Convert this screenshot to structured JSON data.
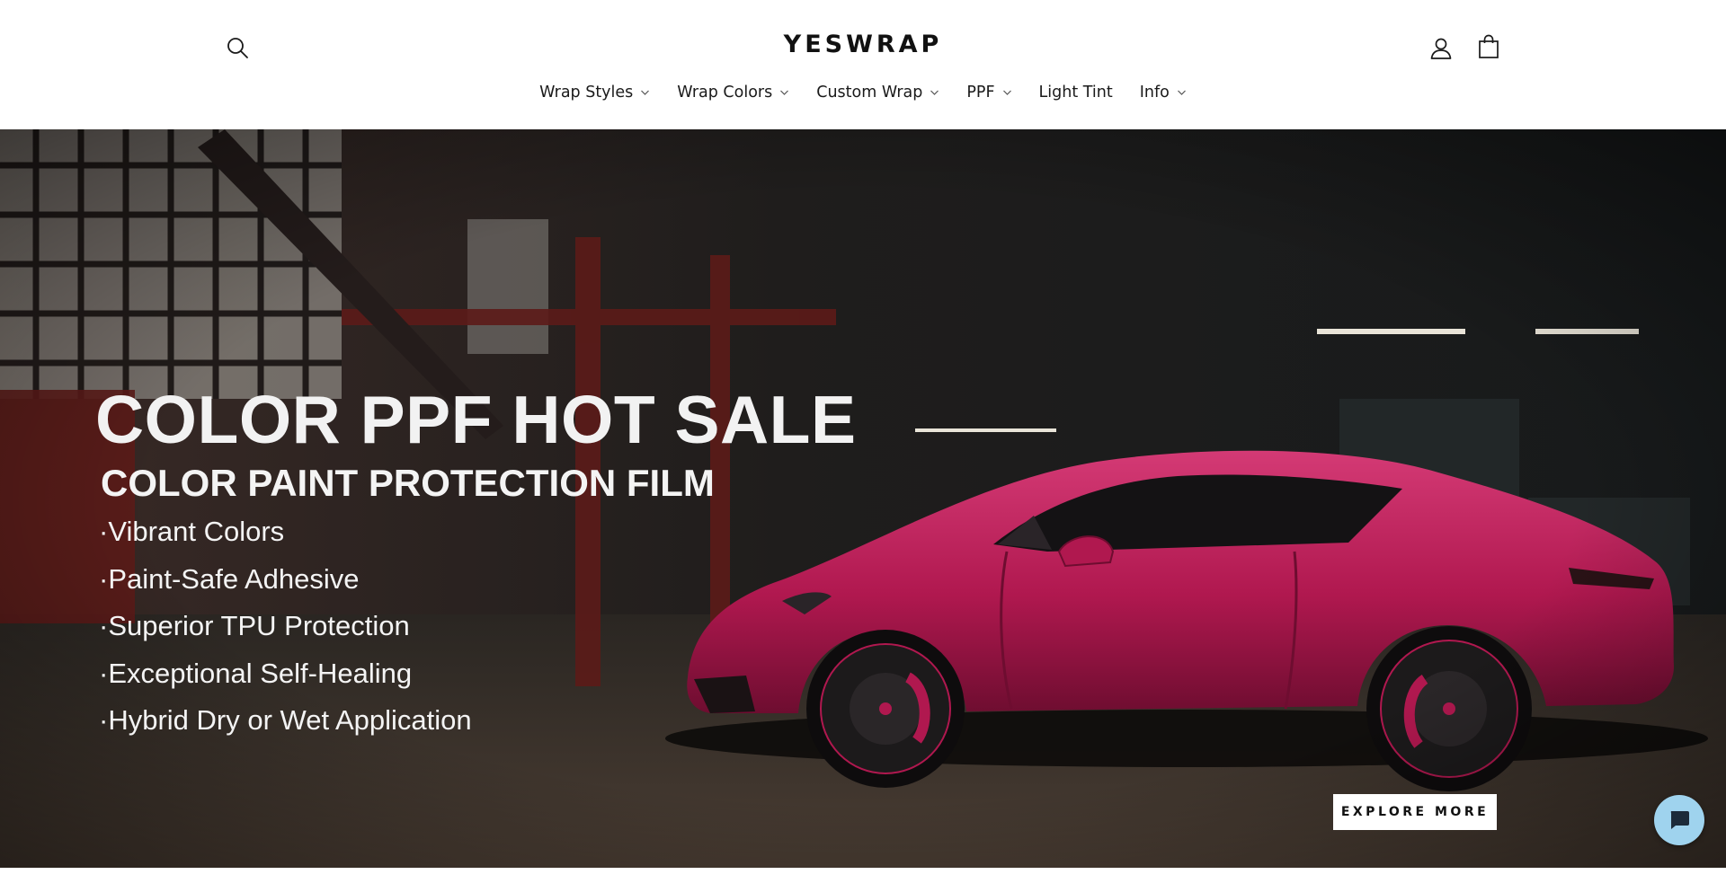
{
  "header": {
    "logo_text": "YESWRAP",
    "search_icon": "search-icon",
    "account_icon": "user-icon",
    "cart_icon": "shopping-bag-icon"
  },
  "nav": {
    "items": [
      {
        "label": "Wrap Styles",
        "has_dropdown": true
      },
      {
        "label": "Wrap Colors",
        "has_dropdown": true
      },
      {
        "label": "Custom Wrap",
        "has_dropdown": true
      },
      {
        "label": "PPF",
        "has_dropdown": true
      },
      {
        "label": "Light Tint",
        "has_dropdown": false
      },
      {
        "label": "Info",
        "has_dropdown": true
      }
    ]
  },
  "hero": {
    "title": "COLOR PPF HOT SALE",
    "subtitle": "COLOR PAINT PROTECTION FILM",
    "features": [
      "·Vibrant Colors",
      "·Paint-Safe Adhesive",
      "·Superior TPU Protection",
      "·Exceptional Self-Healing",
      "·Hybrid Dry or Wet Application"
    ],
    "cta_label": "EXPLORE MORE",
    "car_color": "#b0184f"
  },
  "chat": {
    "icon": "chat-bubble-icon",
    "color": "#9fd3ee"
  }
}
